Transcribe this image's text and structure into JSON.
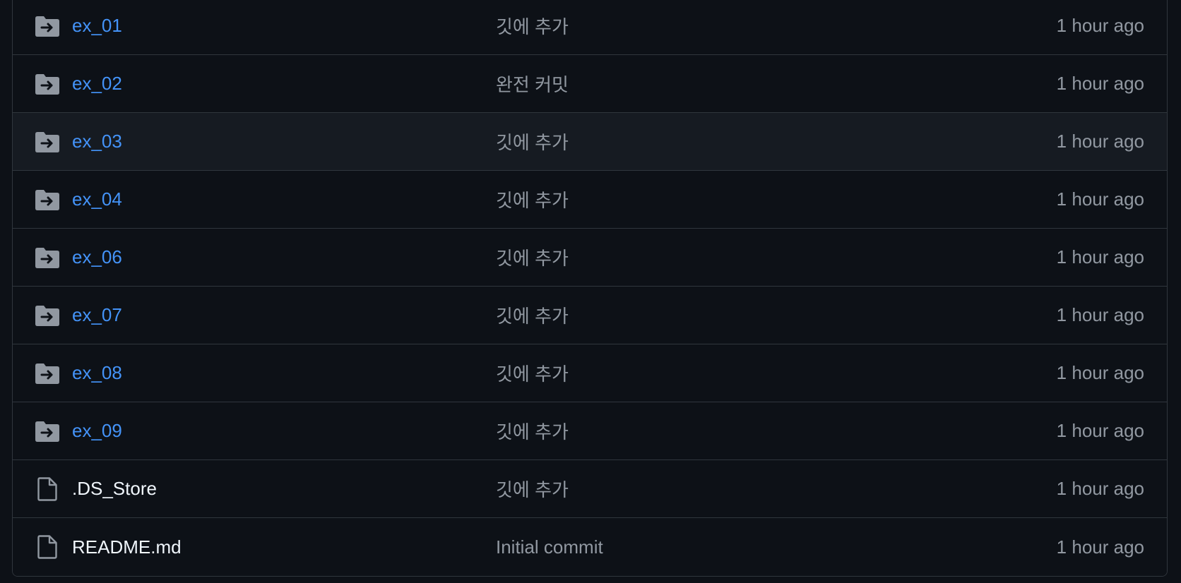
{
  "colors": {
    "background": "#0d1117",
    "row_hover": "#161b22",
    "border": "#30363d",
    "link": "#4493f8",
    "file_name": "#f0f6fc",
    "muted": "#9198a1"
  },
  "files": [
    {
      "name": "ex_01",
      "type": "submodule-folder",
      "icon": "folder-arrow-icon",
      "commit": "깃에 추가",
      "age": "1 hour ago"
    },
    {
      "name": "ex_02",
      "type": "submodule-folder",
      "icon": "folder-arrow-icon",
      "commit": "완전 커밋",
      "age": "1 hour ago"
    },
    {
      "name": "ex_03",
      "type": "submodule-folder",
      "icon": "folder-arrow-icon",
      "commit": "깃에 추가",
      "age": "1 hour ago"
    },
    {
      "name": "ex_04",
      "type": "submodule-folder",
      "icon": "folder-arrow-icon",
      "commit": "깃에 추가",
      "age": "1 hour ago"
    },
    {
      "name": "ex_06",
      "type": "submodule-folder",
      "icon": "folder-arrow-icon",
      "commit": "깃에 추가",
      "age": "1 hour ago"
    },
    {
      "name": "ex_07",
      "type": "submodule-folder",
      "icon": "folder-arrow-icon",
      "commit": "깃에 추가",
      "age": "1 hour ago"
    },
    {
      "name": "ex_08",
      "type": "submodule-folder",
      "icon": "folder-arrow-icon",
      "commit": "깃에 추가",
      "age": "1 hour ago"
    },
    {
      "name": "ex_09",
      "type": "submodule-folder",
      "icon": "folder-arrow-icon",
      "commit": "깃에 추가",
      "age": "1 hour ago"
    },
    {
      "name": ".DS_Store",
      "type": "file",
      "icon": "file-icon",
      "commit": "깃에 추가",
      "age": "1 hour ago"
    },
    {
      "name": "README.md",
      "type": "file",
      "icon": "file-icon",
      "commit": "Initial commit",
      "age": "1 hour ago"
    }
  ]
}
